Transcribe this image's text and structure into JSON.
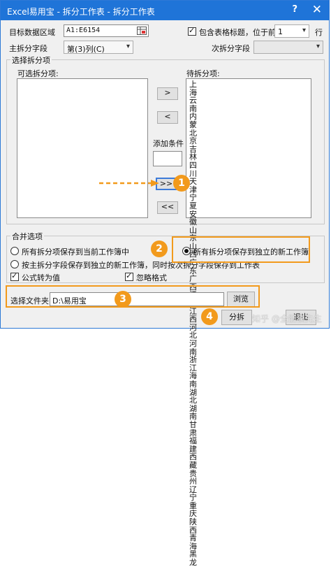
{
  "window": {
    "title": "Excel易用宝 - 拆分工作表 - 拆分工作表",
    "help": "?",
    "close": "✕"
  },
  "target_range": {
    "label": "目标数据区域",
    "value": "A1:E6154",
    "icon": "range-select-icon"
  },
  "header_option": {
    "label": "包含表格标题，位于前",
    "checked": true,
    "value": "1",
    "suffix": "行"
  },
  "main_field": {
    "label": "主拆分字段",
    "value": "第(3)列(C)"
  },
  "sub_field": {
    "label": "次拆分字段",
    "value": ""
  },
  "items_group": {
    "title": "选择拆分项",
    "available_label": "可选拆分项:",
    "pending_label": "待拆分项:",
    "pending_items": "上海云南内蒙北京吉林四川天津宁夏安徽山东山西广东广西江苏江西河北河南浙江海南湖北湖南甘肃福建西藏贵州辽宁重庆陕西青海黑龙",
    "add_condition_label": "添加条件",
    "buttons": {
      "move_right": ">",
      "move_left": "<",
      "move_all_right": ">>",
      "move_all_left": "<<"
    }
  },
  "merge_group": {
    "title": "合并选项",
    "option_current": "所有拆分项保存到当前工作簿中",
    "option_independent": "所有拆分项保存到独立的新工作簿",
    "option_by_field": "按主拆分字段保存到独立的新工作簿，同时按次拆分字段保存到工作表",
    "formula_to_value": "公式转为值",
    "ignore_format": "忽略格式",
    "selected": "option_independent"
  },
  "folder": {
    "label": "选择文件夹",
    "value": "D:\\易用宝",
    "browse": "浏览"
  },
  "footer": {
    "split": "分拆",
    "exit": "退出",
    "watermark": "知乎 @全能猫先生"
  },
  "annotations": {
    "badge1": "1",
    "badge2": "2",
    "badge3": "3",
    "badge4": "4",
    "accent": "#f29a1c"
  }
}
